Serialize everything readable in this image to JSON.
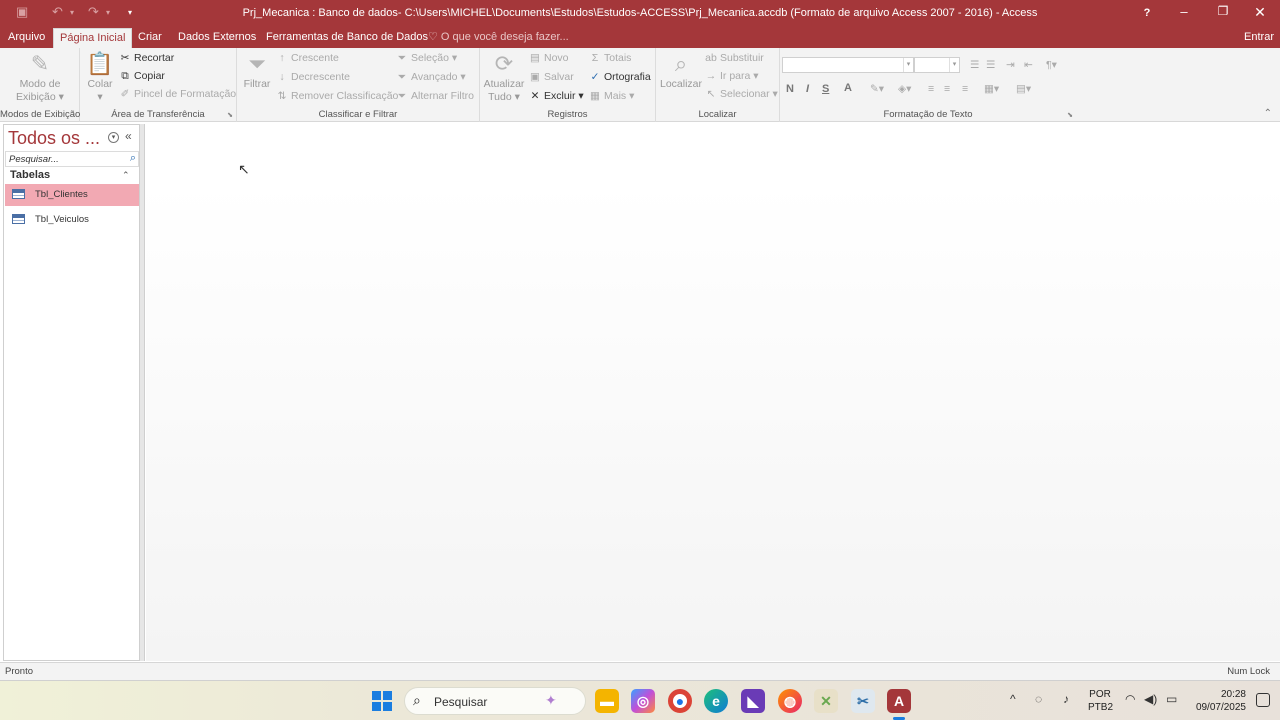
{
  "titlebar": {
    "title": "Prj_Mecanica : Banco de dados- C:\\Users\\MICHEL\\Documents\\Estudos\\Estudos-ACCESS\\Prj_Mecanica.accdb (Formato de arquivo Access 2007 - 2016) - Access",
    "help": "?"
  },
  "tabs": {
    "items": [
      "Arquivo",
      "Página Inicial",
      "Criar",
      "Dados Externos",
      "Ferramentas de Banco de Dados"
    ],
    "tell_me": "O que você deseja fazer...",
    "sign_in": "Entrar"
  },
  "ribbon": {
    "views": {
      "button_line1": "Modo de",
      "button_line2": "Exibição",
      "label": "Modos de Exibição"
    },
    "clipboard": {
      "paste": "Colar",
      "cut": "Recortar",
      "copy": "Copiar",
      "format_painter": "Pincel de Formatação",
      "label": "Área de Transferência"
    },
    "sort_filter": {
      "filter": "Filtrar",
      "ascending": "Crescente",
      "descending": "Decrescente",
      "remove_sort": "Remover Classificação",
      "selection": "Seleção",
      "advanced": "Avançado",
      "toggle_filter": "Alternar Filtro",
      "label": "Classificar e Filtrar"
    },
    "records": {
      "refresh_line1": "Atualizar",
      "refresh_line2": "Tudo",
      "new": "Novo",
      "save": "Salvar",
      "delete": "Excluir",
      "totals": "Totais",
      "spelling": "Ortografia",
      "more": "Mais",
      "label": "Registros"
    },
    "find": {
      "find": "Localizar",
      "replace": "Substituir",
      "goto": "Ir para",
      "select": "Selecionar",
      "label": "Localizar"
    },
    "text_formatting": {
      "bold": "N",
      "italic": "I",
      "underline": "S",
      "font_color": "A",
      "label": "Formatação de Texto"
    }
  },
  "nav_pane": {
    "title": "Todos os ...",
    "search_placeholder": "Pesquisar...",
    "group": "Tabelas",
    "items": [
      {
        "label": "Tbl_Clientes",
        "selected": true
      },
      {
        "label": "Tbl_Veiculos",
        "selected": false
      }
    ]
  },
  "statusbar": {
    "left": "Pronto",
    "right": "Num Lock"
  },
  "taskbar": {
    "search": "Pesquisar",
    "language_line1": "POR",
    "language_line2": "PTB2",
    "time": "20:28",
    "date": "09/07/2025"
  },
  "colors": {
    "accent": "#a4373a",
    "selection": "#f2a9b3",
    "windows_blue": "#1a7de0"
  }
}
